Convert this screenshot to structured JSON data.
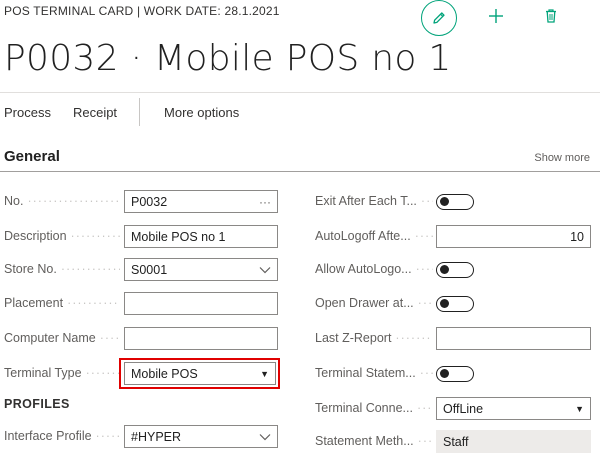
{
  "header": {
    "caption": "POS TERMINAL CARD | WORK DATE: 28.1.2021",
    "title": "P0032 · Mobile POS no 1",
    "icons": {
      "edit": "pencil-icon",
      "new": "plus-icon",
      "delete": "trash-icon"
    },
    "accent_color": "#00a37a"
  },
  "actions": {
    "process": "Process",
    "receipt": "Receipt",
    "more": "More options"
  },
  "section": {
    "title": "General",
    "show_more": "Show more"
  },
  "fields_left": {
    "no": {
      "label": "No.",
      "value": "P0032",
      "suffix": "···"
    },
    "description": {
      "label": "Description",
      "value": "Mobile POS no 1"
    },
    "store_no": {
      "label": "Store No.",
      "value": "S0001"
    },
    "placement": {
      "label": "Placement",
      "value": ""
    },
    "computer_name": {
      "label": "Computer Name",
      "value": ""
    },
    "terminal_type": {
      "label": "Terminal Type",
      "value": "Mobile POS"
    },
    "profiles_heading": "PROFILES",
    "interface_profile": {
      "label": "Interface Profile",
      "value": "#HYPER"
    }
  },
  "fields_right": {
    "exit_after_each": {
      "label": "Exit After Each T...",
      "value": false
    },
    "autologoff_after": {
      "label": "AutoLogoff Afte...",
      "value": "10"
    },
    "allow_autologoff": {
      "label": "Allow AutoLogo...",
      "value": false
    },
    "open_drawer": {
      "label": "Open Drawer at...",
      "value": false
    },
    "last_z_report": {
      "label": "Last Z-Report",
      "value": ""
    },
    "terminal_statement": {
      "label": "Terminal Statem...",
      "value": false
    },
    "terminal_connection": {
      "label": "Terminal Conne...",
      "value": "OffLine"
    },
    "statement_method": {
      "label": "Statement Meth...",
      "value": "Staff"
    }
  },
  "highlight_color": "#e00000"
}
